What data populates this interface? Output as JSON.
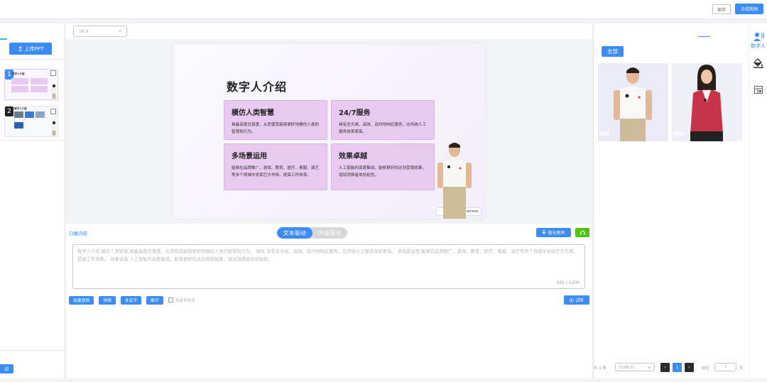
{
  "topbar": {
    "save_label": "保存",
    "make_video_label": "合成视频"
  },
  "left": {
    "upload_label": "上传PPT",
    "thumbs": [
      {
        "number": "1",
        "title": "数字人介绍"
      },
      {
        "number": "2",
        "title": "数字人介绍"
      }
    ],
    "bottom_btn_label": "自"
  },
  "center": {
    "select_placeholder": "16:9",
    "slide": {
      "title": "数字人介绍",
      "cards": [
        {
          "heading": "模仿人类智慧",
          "text": "具备高度仿真度，从而使其能够更好地模仿人类的智慧和行为。"
        },
        {
          "heading": "24/7服务",
          "text": "具有全天候、高效、及时地响应服务，比传统人工服务效率更高。"
        },
        {
          "heading": "多场景运用",
          "text": "能够在品牌推广、游戏、教育、医疗、客服、演艺等多个领域中发挥巨大作用，提高工作效率。"
        },
        {
          "heading": "效果卓越",
          "text": "人工智能的高度集成，能够更好的达到营销效果，增加消费者体验粘性。"
        }
      ],
      "presenter_tag": "emma"
    },
    "clear_label": "口播内容",
    "drive_tabs": [
      "文本驱动",
      "声音驱动"
    ],
    "voice_label": "阳光男声",
    "script_text": "数字人介绍  模仿人类智慧  具备高度仿真度，从而使其能够更好地模仿人类的智慧和行为。  服务 具有全天候、高效、及时地响应服务，比传统人工服务效率更高。  多场景运用 能够在品牌推广、游戏、教育、医疗、客服、演艺等多个领域中发挥巨大作用，提高工作效率。  效果卓越 人工智能的高度集成，能够更好的达到营销效果，增加消费者体验粘性。",
    "char_count": "165 / 1200",
    "tools": [
      "批量替换",
      "停顿",
      "多音字",
      "数字"
    ],
    "polyphone_check_label": "多音字检测",
    "listen_label": "试听"
  },
  "right": {
    "all_label": "全部",
    "pager": {
      "total": "共 2 条",
      "per_page": "100条/页",
      "prev": "‹",
      "current": "1",
      "next": "›",
      "goto_label": "前往",
      "goto_value": "1",
      "page_suffix": "页"
    }
  },
  "far_right": {
    "digital_human_label": "数字人"
  },
  "colors": {
    "primary": "#3b8cf7",
    "card": "#e8c9ef",
    "green": "#52c41a"
  }
}
